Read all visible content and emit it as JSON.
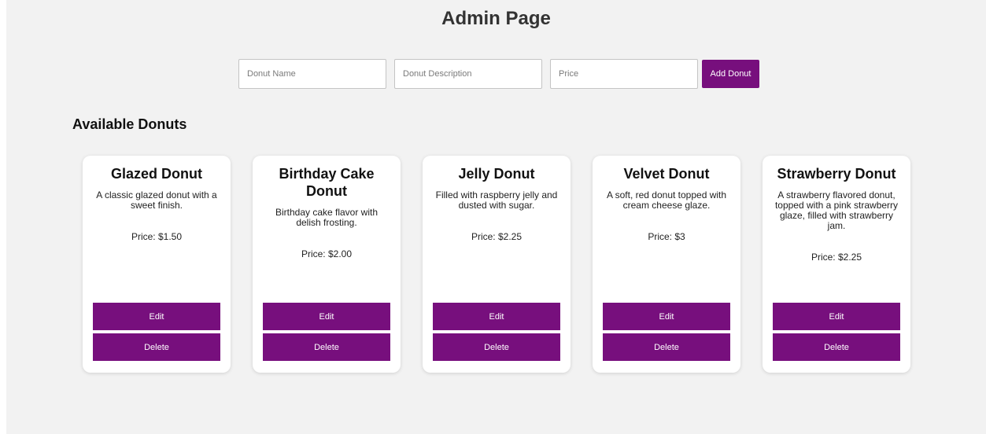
{
  "page": {
    "title": "Admin Page"
  },
  "form": {
    "name_placeholder": "Donut Name",
    "description_placeholder": "Donut Description",
    "price_placeholder": "Price",
    "add_label": "Add Donut"
  },
  "section_title": "Available Donuts",
  "donuts": [
    {
      "name": "Glazed Donut",
      "description": "A classic glazed donut with a sweet finish.",
      "price": "Price: $1.50",
      "edit_label": "Edit",
      "delete_label": "Delete"
    },
    {
      "name": "Birthday Cake Donut",
      "description": "Birthday cake flavor with delish frosting.",
      "price": "Price: $2.00",
      "edit_label": "Edit",
      "delete_label": "Delete"
    },
    {
      "name": "Jelly Donut",
      "description": "Filled with raspberry jelly and dusted with sugar.",
      "price": "Price: $2.25",
      "edit_label": "Edit",
      "delete_label": "Delete"
    },
    {
      "name": "Velvet Donut",
      "description": "A soft, red donut topped with cream cheese glaze.",
      "price": "Price: $3",
      "edit_label": "Edit",
      "delete_label": "Delete"
    },
    {
      "name": "Strawberry Donut",
      "description": "A strawberry flavored donut, topped with a pink strawberry glaze, filled with strawberry jam.",
      "price": "Price: $2.25",
      "edit_label": "Edit",
      "delete_label": "Delete"
    }
  ],
  "colors": {
    "accent": "#770f7d",
    "background": "#f2f2f2",
    "card": "#ffffff"
  }
}
